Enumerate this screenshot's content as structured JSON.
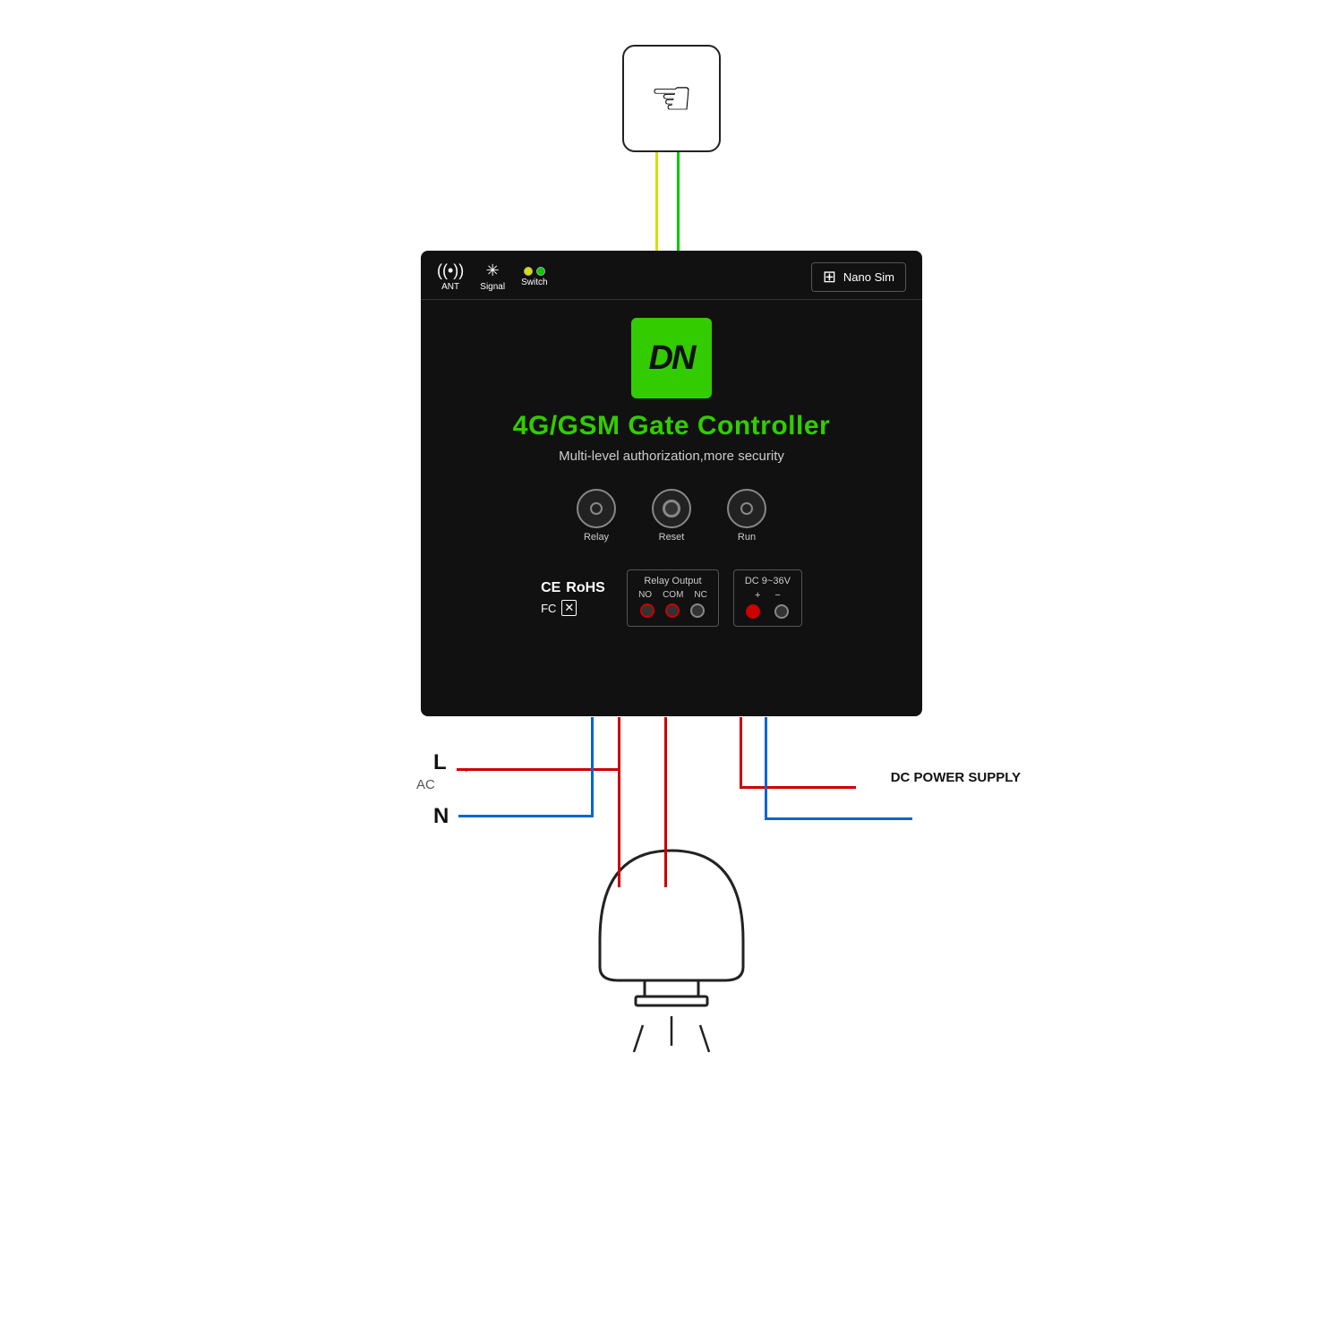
{
  "device": {
    "title": "4G/GSM Gate Controller",
    "subtitle": "Multi-level authorization,more security",
    "logo_text": "DN",
    "top_labels": {
      "ant": "ANT",
      "signal": "Signal",
      "switch": "Switch",
      "nano_sim": "Nano Sim"
    },
    "indicators": {
      "relay_label": "Relay",
      "reset_label": "Reset",
      "run_label": "Run"
    },
    "relay_output": {
      "title": "Relay Output",
      "labels": [
        "NO",
        "COM",
        "NC"
      ]
    },
    "dc_power": {
      "title": "DC 9~36V",
      "labels": [
        "+",
        "-"
      ]
    },
    "certifications": [
      "CE",
      "RoHS",
      "FC"
    ]
  },
  "wiring": {
    "L_label": "L",
    "AC_label": "AC",
    "N_label": "N",
    "dc_power_label": "DC POWER\nSUPPLY"
  },
  "colors": {
    "green_accent": "#33cc00",
    "red_wire": "#cc0000",
    "blue_wire": "#0066cc",
    "yellow_wire": "#d4e000",
    "device_bg": "#111111"
  }
}
